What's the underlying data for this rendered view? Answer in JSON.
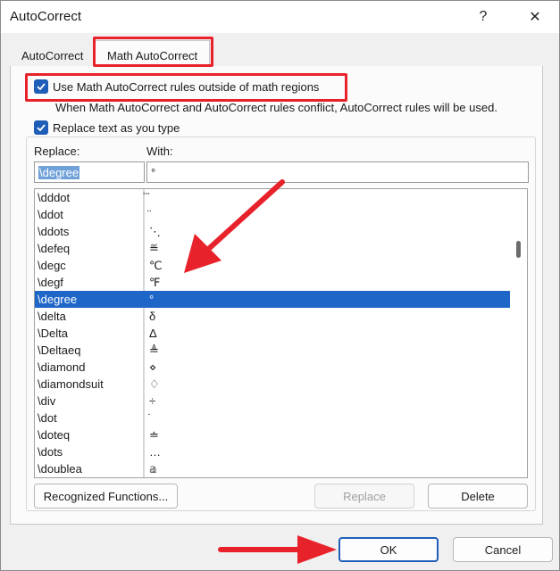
{
  "window": {
    "title": "AutoCorrect",
    "help_icon": "?",
    "close_icon": "✕"
  },
  "tabs": [
    {
      "label": "AutoCorrect"
    },
    {
      "label": "Math AutoCorrect"
    }
  ],
  "options": {
    "use_outside_math": "Use Math AutoCorrect rules outside of math regions",
    "conflict_note": "When Math AutoCorrect and AutoCorrect rules conflict, AutoCorrect rules will be used.",
    "replace_as_you_type": "Replace text as you type"
  },
  "fields": {
    "replace_label": "Replace:",
    "with_label": "With:",
    "replace_value": "\\degree",
    "with_value": "°"
  },
  "list": [
    {
      "replace": "\\dddot",
      "with": "⃛"
    },
    {
      "replace": "\\ddot",
      "with": "̈"
    },
    {
      "replace": "\\ddots",
      "with": "⋱"
    },
    {
      "replace": "\\defeq",
      "with": "≝"
    },
    {
      "replace": "\\degc",
      "with": "℃"
    },
    {
      "replace": "\\degf",
      "with": "℉"
    },
    {
      "replace": "\\degree",
      "with": "°"
    },
    {
      "replace": "\\delta",
      "with": "δ"
    },
    {
      "replace": "\\Delta",
      "with": "Δ"
    },
    {
      "replace": "\\Deltaeq",
      "with": "≜"
    },
    {
      "replace": "\\diamond",
      "with": "⋄"
    },
    {
      "replace": "\\diamondsuit",
      "with": "♢"
    },
    {
      "replace": "\\div",
      "with": "÷"
    },
    {
      "replace": "\\dot",
      "with": "̇"
    },
    {
      "replace": "\\doteq",
      "with": "≐"
    },
    {
      "replace": "\\dots",
      "with": "…"
    },
    {
      "replace": "\\doublea",
      "with": "𝕒"
    }
  ],
  "selected_index": 6,
  "buttons": {
    "recognized_functions": "Recognized Functions...",
    "replace": "Replace",
    "delete": "Delete",
    "ok": "OK",
    "cancel": "Cancel"
  },
  "colors": {
    "accent": "#1e5eb8",
    "selection": "#1e66c8",
    "annotation_red": "#e8222a"
  }
}
